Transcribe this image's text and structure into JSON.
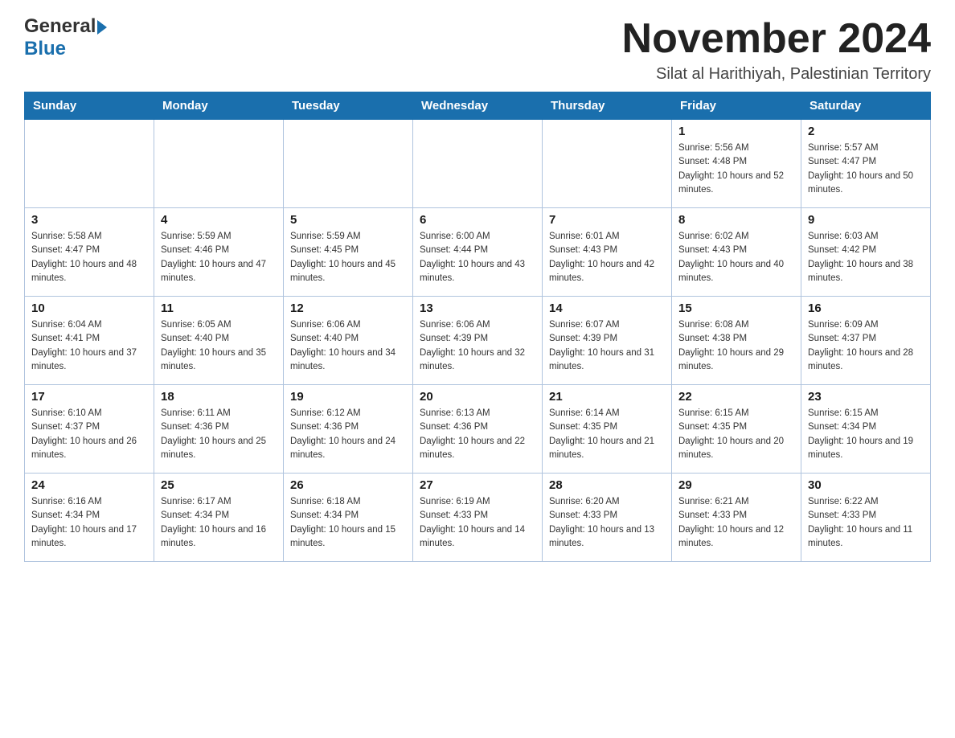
{
  "logo": {
    "general": "General",
    "blue": "Blue"
  },
  "header": {
    "month_year": "November 2024",
    "location": "Silat al Harithiyah, Palestinian Territory"
  },
  "days_of_week": [
    "Sunday",
    "Monday",
    "Tuesday",
    "Wednesday",
    "Thursday",
    "Friday",
    "Saturday"
  ],
  "weeks": [
    [
      {
        "day": "",
        "info": ""
      },
      {
        "day": "",
        "info": ""
      },
      {
        "day": "",
        "info": ""
      },
      {
        "day": "",
        "info": ""
      },
      {
        "day": "",
        "info": ""
      },
      {
        "day": "1",
        "info": "Sunrise: 5:56 AM\nSunset: 4:48 PM\nDaylight: 10 hours and 52 minutes."
      },
      {
        "day": "2",
        "info": "Sunrise: 5:57 AM\nSunset: 4:47 PM\nDaylight: 10 hours and 50 minutes."
      }
    ],
    [
      {
        "day": "3",
        "info": "Sunrise: 5:58 AM\nSunset: 4:47 PM\nDaylight: 10 hours and 48 minutes."
      },
      {
        "day": "4",
        "info": "Sunrise: 5:59 AM\nSunset: 4:46 PM\nDaylight: 10 hours and 47 minutes."
      },
      {
        "day": "5",
        "info": "Sunrise: 5:59 AM\nSunset: 4:45 PM\nDaylight: 10 hours and 45 minutes."
      },
      {
        "day": "6",
        "info": "Sunrise: 6:00 AM\nSunset: 4:44 PM\nDaylight: 10 hours and 43 minutes."
      },
      {
        "day": "7",
        "info": "Sunrise: 6:01 AM\nSunset: 4:43 PM\nDaylight: 10 hours and 42 minutes."
      },
      {
        "day": "8",
        "info": "Sunrise: 6:02 AM\nSunset: 4:43 PM\nDaylight: 10 hours and 40 minutes."
      },
      {
        "day": "9",
        "info": "Sunrise: 6:03 AM\nSunset: 4:42 PM\nDaylight: 10 hours and 38 minutes."
      }
    ],
    [
      {
        "day": "10",
        "info": "Sunrise: 6:04 AM\nSunset: 4:41 PM\nDaylight: 10 hours and 37 minutes."
      },
      {
        "day": "11",
        "info": "Sunrise: 6:05 AM\nSunset: 4:40 PM\nDaylight: 10 hours and 35 minutes."
      },
      {
        "day": "12",
        "info": "Sunrise: 6:06 AM\nSunset: 4:40 PM\nDaylight: 10 hours and 34 minutes."
      },
      {
        "day": "13",
        "info": "Sunrise: 6:06 AM\nSunset: 4:39 PM\nDaylight: 10 hours and 32 minutes."
      },
      {
        "day": "14",
        "info": "Sunrise: 6:07 AM\nSunset: 4:39 PM\nDaylight: 10 hours and 31 minutes."
      },
      {
        "day": "15",
        "info": "Sunrise: 6:08 AM\nSunset: 4:38 PM\nDaylight: 10 hours and 29 minutes."
      },
      {
        "day": "16",
        "info": "Sunrise: 6:09 AM\nSunset: 4:37 PM\nDaylight: 10 hours and 28 minutes."
      }
    ],
    [
      {
        "day": "17",
        "info": "Sunrise: 6:10 AM\nSunset: 4:37 PM\nDaylight: 10 hours and 26 minutes."
      },
      {
        "day": "18",
        "info": "Sunrise: 6:11 AM\nSunset: 4:36 PM\nDaylight: 10 hours and 25 minutes."
      },
      {
        "day": "19",
        "info": "Sunrise: 6:12 AM\nSunset: 4:36 PM\nDaylight: 10 hours and 24 minutes."
      },
      {
        "day": "20",
        "info": "Sunrise: 6:13 AM\nSunset: 4:36 PM\nDaylight: 10 hours and 22 minutes."
      },
      {
        "day": "21",
        "info": "Sunrise: 6:14 AM\nSunset: 4:35 PM\nDaylight: 10 hours and 21 minutes."
      },
      {
        "day": "22",
        "info": "Sunrise: 6:15 AM\nSunset: 4:35 PM\nDaylight: 10 hours and 20 minutes."
      },
      {
        "day": "23",
        "info": "Sunrise: 6:15 AM\nSunset: 4:34 PM\nDaylight: 10 hours and 19 minutes."
      }
    ],
    [
      {
        "day": "24",
        "info": "Sunrise: 6:16 AM\nSunset: 4:34 PM\nDaylight: 10 hours and 17 minutes."
      },
      {
        "day": "25",
        "info": "Sunrise: 6:17 AM\nSunset: 4:34 PM\nDaylight: 10 hours and 16 minutes."
      },
      {
        "day": "26",
        "info": "Sunrise: 6:18 AM\nSunset: 4:34 PM\nDaylight: 10 hours and 15 minutes."
      },
      {
        "day": "27",
        "info": "Sunrise: 6:19 AM\nSunset: 4:33 PM\nDaylight: 10 hours and 14 minutes."
      },
      {
        "day": "28",
        "info": "Sunrise: 6:20 AM\nSunset: 4:33 PM\nDaylight: 10 hours and 13 minutes."
      },
      {
        "day": "29",
        "info": "Sunrise: 6:21 AM\nSunset: 4:33 PM\nDaylight: 10 hours and 12 minutes."
      },
      {
        "day": "30",
        "info": "Sunrise: 6:22 AM\nSunset: 4:33 PM\nDaylight: 10 hours and 11 minutes."
      }
    ]
  ]
}
